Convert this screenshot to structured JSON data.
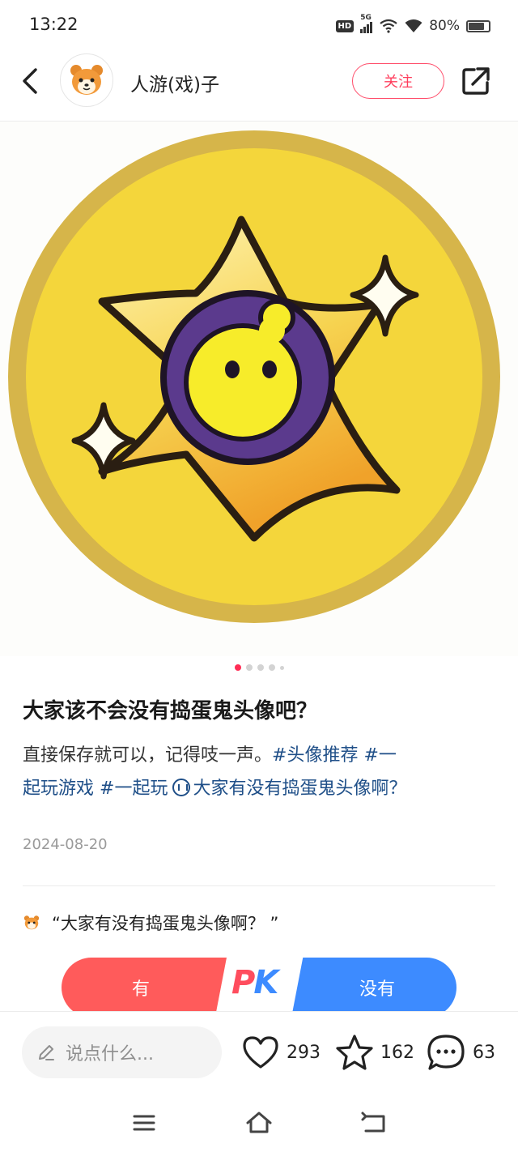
{
  "status_bar": {
    "time": "13:22",
    "hd": "HD",
    "network": "5G",
    "battery": "80%",
    "battery_level": 0.8
  },
  "header": {
    "author": "人游(戏)子",
    "follow_label": "关注"
  },
  "carousel": {
    "total": 5,
    "active_index": 0
  },
  "post": {
    "title": "大家该不会没有捣蛋鬼头像吧？",
    "body_text": "直接保存就可以，记得吱一声。",
    "tag1": "#头像推荐",
    "tag2_part1": "#一",
    "tag2_part2": "起玩游戏",
    "tag3": "#一起玩",
    "topic": "大家有没有捣蛋鬼头像啊？",
    "date": "2024-08-20"
  },
  "vote": {
    "title": "“大家有没有捣蛋鬼头像啊？ ”",
    "yes_label": "有",
    "no_label": "没有",
    "pk_p": "P",
    "pk_k": "K"
  },
  "bottom_bar": {
    "comment_placeholder": "说点什么...",
    "likes": "293",
    "favorites": "162",
    "comments": "63"
  },
  "colors": {
    "accent_red": "#ff3d5c",
    "vote_yes": "#ff5b5b",
    "vote_no": "#3d8bff",
    "tag_blue": "#1f4f88",
    "coin_gold": "#d9b443",
    "coin_inner": "#f6d83a"
  },
  "icons": {
    "back": "chevron-left-icon",
    "share": "share-out-icon",
    "edit": "pencil-icon",
    "like": "heart-icon",
    "favorite": "star-icon",
    "comment": "comment-bubble-icon",
    "nav_menu": "menu-icon",
    "nav_home": "home-icon",
    "nav_back": "return-icon"
  }
}
